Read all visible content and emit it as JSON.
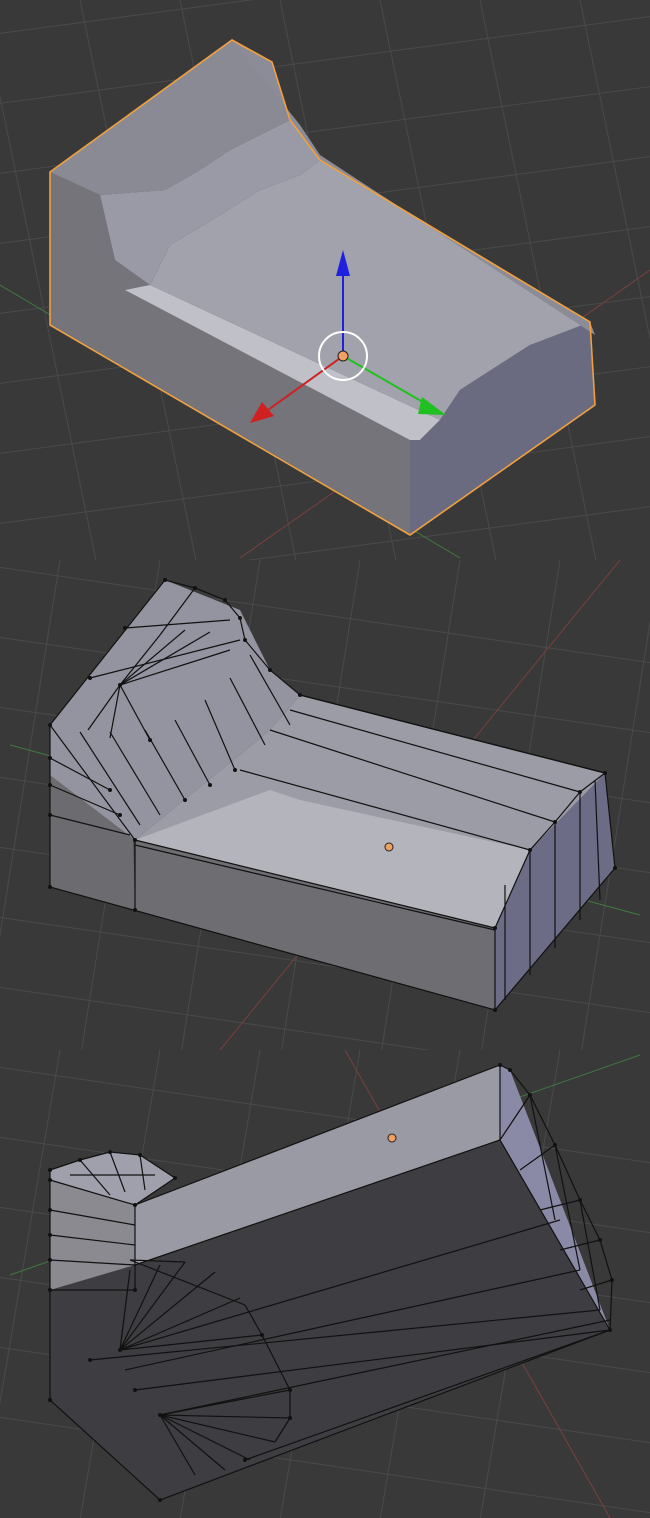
{
  "app": "3D Viewport",
  "views": [
    {
      "name": "object-mode-solid",
      "selected": true,
      "transform_widget": true
    },
    {
      "name": "edit-mode-top-wireframe",
      "selected": false
    },
    {
      "name": "edit-mode-bottom-wireframe",
      "selected": false
    }
  ],
  "colors": {
    "background": "#393939",
    "grid": "#4a4a4a",
    "selection_outline": "#f0a040",
    "x_axis": "#d02020",
    "y_axis": "#20c020",
    "z_axis": "#2020e0",
    "origin": "#f0a060"
  },
  "icons": [
    "transform-manipulator-icon",
    "object-origin-icon"
  ]
}
